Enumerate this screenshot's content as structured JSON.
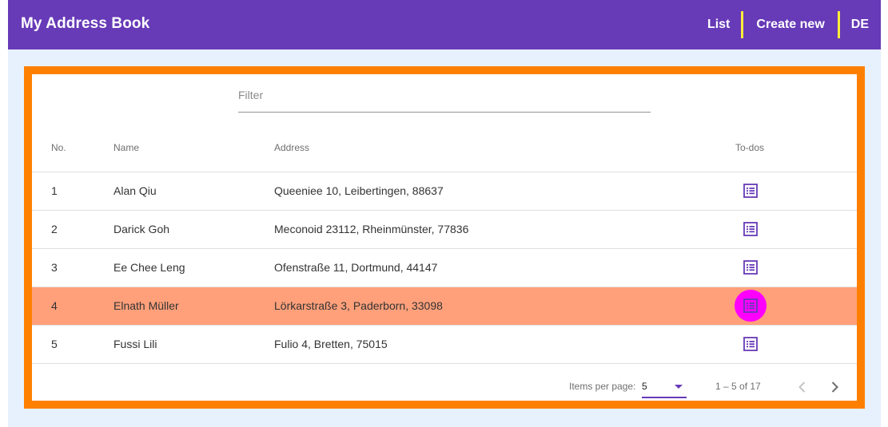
{
  "toolbar": {
    "title": "My Address Book",
    "nav": [
      "List",
      "Create new",
      "DE"
    ]
  },
  "filter": {
    "placeholder": "Filter",
    "value": ""
  },
  "table": {
    "headers": {
      "no": "No.",
      "name": "Name",
      "address": "Address",
      "todos": "To-dos"
    },
    "rows": [
      {
        "no": "1",
        "name": "Alan Qiu",
        "address": "Queeniee 10, Leibertingen, 88637"
      },
      {
        "no": "2",
        "name": "Darick Goh",
        "address": "Meconoid 23112, Rheinmünster, 77836"
      },
      {
        "no": "3",
        "name": "Ee Chee Leng",
        "address": "Ofenstraße 11, Dortmund, 44147"
      },
      {
        "no": "4",
        "name": "Elnath Müller",
        "address": "Lörkarstraße 3, Paderborn, 33098"
      },
      {
        "no": "5",
        "name": "Fussi Lili",
        "address": "Fulio 4, Bretten, 75015"
      }
    ],
    "todo_icon": "list-icon",
    "highlighted_row": "4"
  },
  "paginator": {
    "items_per_page_label": "Items per page:",
    "page_size": "5",
    "range_label": "1 – 5 of 17"
  },
  "colors": {
    "primary": "#673ab7",
    "accent_border": "#ff8000",
    "highlight_row": "#ffa07a",
    "highlight_button": "#ff00ff",
    "nav_separator": "#ffeb3b",
    "background": "#e6f1fd"
  }
}
